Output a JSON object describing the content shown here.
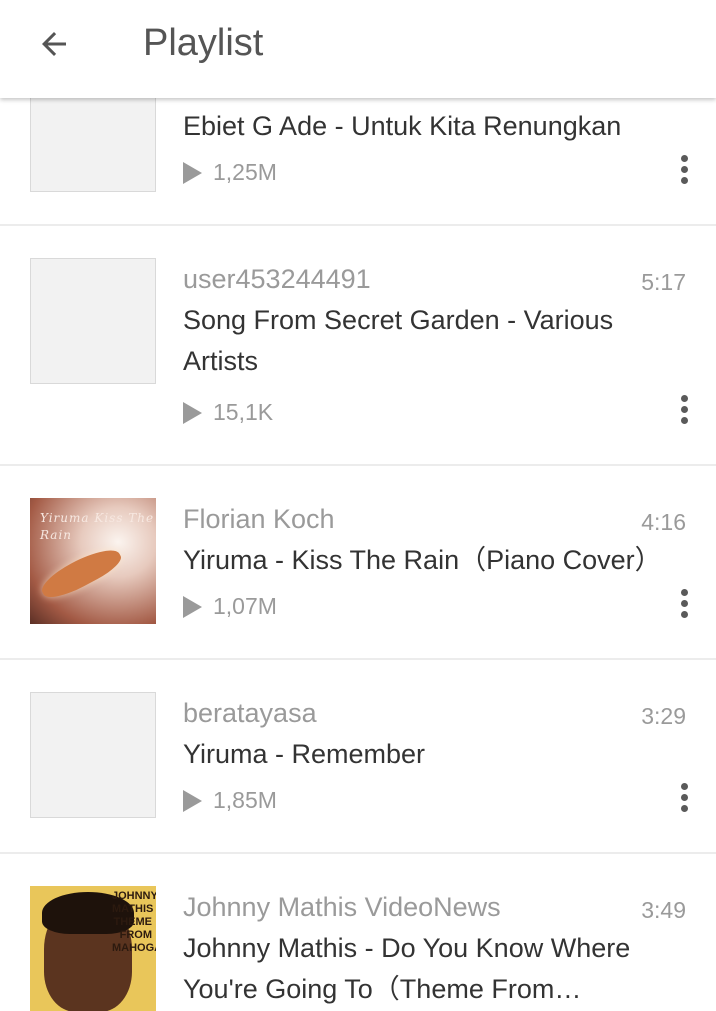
{
  "header": {
    "title": "Playlist",
    "back_icon": "arrow-left-icon"
  },
  "tracks": [
    {
      "uploader": "",
      "duration": "",
      "title": "Ebiet G Ade - Untuk Kita Renungkan",
      "plays": "1,25M",
      "artwork": "placeholder"
    },
    {
      "uploader": "user453244491",
      "duration": "5:17",
      "title": "Song From Secret Garden - Various Artists",
      "plays": "15,1K",
      "artwork": "placeholder"
    },
    {
      "uploader": "Florian Koch",
      "duration": "4:16",
      "title": "Yiruma - Kiss The Rain（Piano Cover）",
      "plays": "1,07M",
      "artwork": "kiss-the-rain-cover",
      "artwork_text": "Yiruma Kiss The Rain"
    },
    {
      "uploader": "beratayasa",
      "duration": "3:29",
      "title": "Yiruma - Remember",
      "plays": "1,85M",
      "artwork": "placeholder"
    },
    {
      "uploader": "Johnny Mathis VideoNews",
      "duration": "3:49",
      "title": "Johnny Mathis - Do You Know Where You're Going To（Theme From Mahogany）",
      "plays": "",
      "artwork": "johnny-mathis-cover",
      "artwork_text": "JOHNNY MATHIS THEME FROM MAHOGANY"
    }
  ],
  "colors": {
    "secondary_text": "#9a9a9a",
    "primary_text": "#333333",
    "divider": "#ececec",
    "placeholder": "#f2f2f2"
  }
}
